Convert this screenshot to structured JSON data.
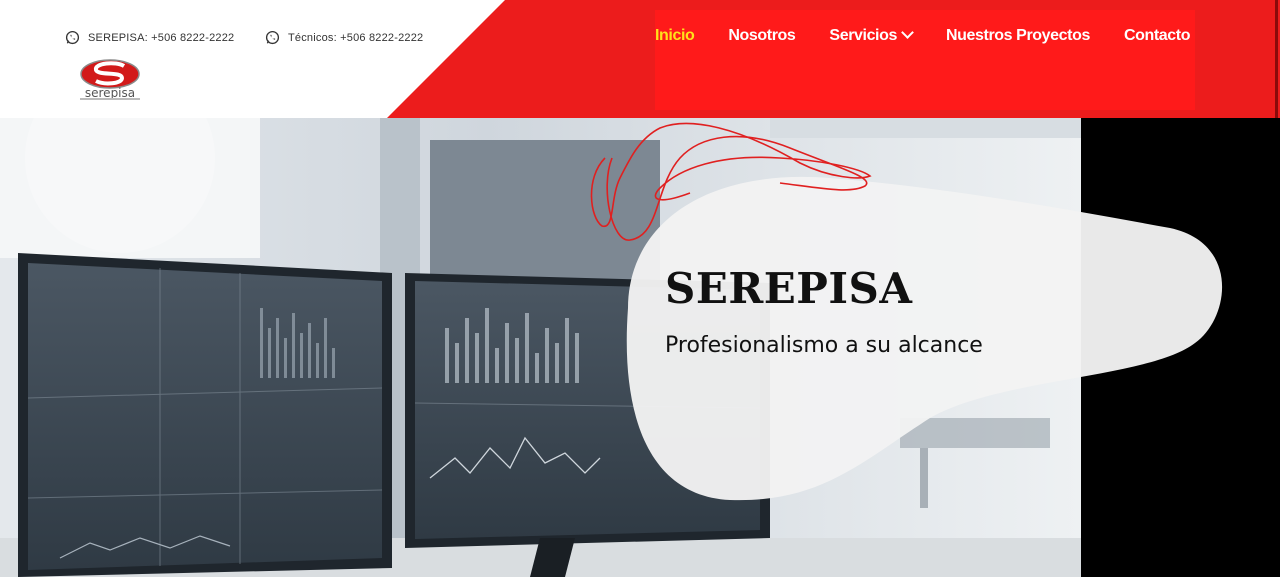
{
  "contacts": [
    {
      "label": "SEREPISA: +506 8222-2222",
      "icon": "whatsapp-icon"
    },
    {
      "label": "Técnicos: +506 8222-2222",
      "icon": "whatsapp-icon"
    }
  ],
  "logo": {
    "text": "serepisa"
  },
  "nav": {
    "items": [
      {
        "label": "Inicio",
        "active": true
      },
      {
        "label": "Nosotros"
      },
      {
        "label": "Servicios",
        "dropdown": true
      },
      {
        "label": "Nuestros Proyectos"
      },
      {
        "label": "Contacto"
      }
    ]
  },
  "hero": {
    "title": "SEREPISA",
    "subtitle": "Profesionalismo a su alcance"
  },
  "colors": {
    "brand_red": "#ec1c1c",
    "nav_active": "#ffe11a",
    "blob": "#f3f3f3"
  }
}
